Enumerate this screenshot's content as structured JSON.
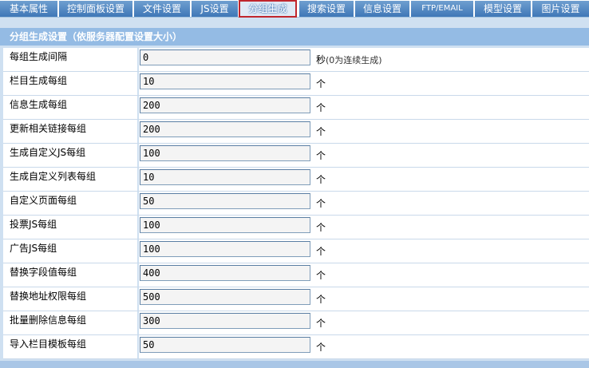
{
  "tabs": [
    {
      "label": "基本属性"
    },
    {
      "label": "控制面板设置"
    },
    {
      "label": "文件设置"
    },
    {
      "label": "JS设置"
    },
    {
      "label": "分组生成"
    },
    {
      "label": "搜索设置"
    },
    {
      "label": "信息设置"
    },
    {
      "label": "FTP/EMAIL"
    },
    {
      "label": "模型设置"
    },
    {
      "label": "图片设置"
    }
  ],
  "active_tab": "分组生成",
  "panel": {
    "title": "分组生成设置（依服务器配置设置大小）"
  },
  "rows": [
    {
      "label": "每组生成间隔",
      "value": "0",
      "unit": "秒",
      "note": "(0为连续生成)"
    },
    {
      "label": "栏目生成每组",
      "value": "10",
      "unit": "个"
    },
    {
      "label": "信息生成每组",
      "value": "200",
      "unit": "个"
    },
    {
      "label": "更新相关链接每组",
      "value": "200",
      "unit": "个"
    },
    {
      "label": "生成自定义JS每组",
      "value": "100",
      "unit": "个"
    },
    {
      "label": "生成自定义列表每组",
      "value": "10",
      "unit": "个"
    },
    {
      "label": "自定义页面每组",
      "value": "50",
      "unit": "个"
    },
    {
      "label": "投票JS每组",
      "value": "100",
      "unit": "个"
    },
    {
      "label": "广告JS每组",
      "value": "100",
      "unit": "个"
    },
    {
      "label": "替换字段值每组",
      "value": "400",
      "unit": "个"
    },
    {
      "label": "替换地址权限每组",
      "value": "500",
      "unit": "个"
    },
    {
      "label": "批量删除信息每组",
      "value": "300",
      "unit": "个"
    },
    {
      "label": "导入栏目模板每组",
      "value": "50",
      "unit": "个"
    }
  ],
  "colors": {
    "tab_bg": "#3f77b7",
    "active_tab_border": "#c0262d",
    "header_bg": "#94bbe4",
    "panel_bg": "#cfe0f1"
  }
}
